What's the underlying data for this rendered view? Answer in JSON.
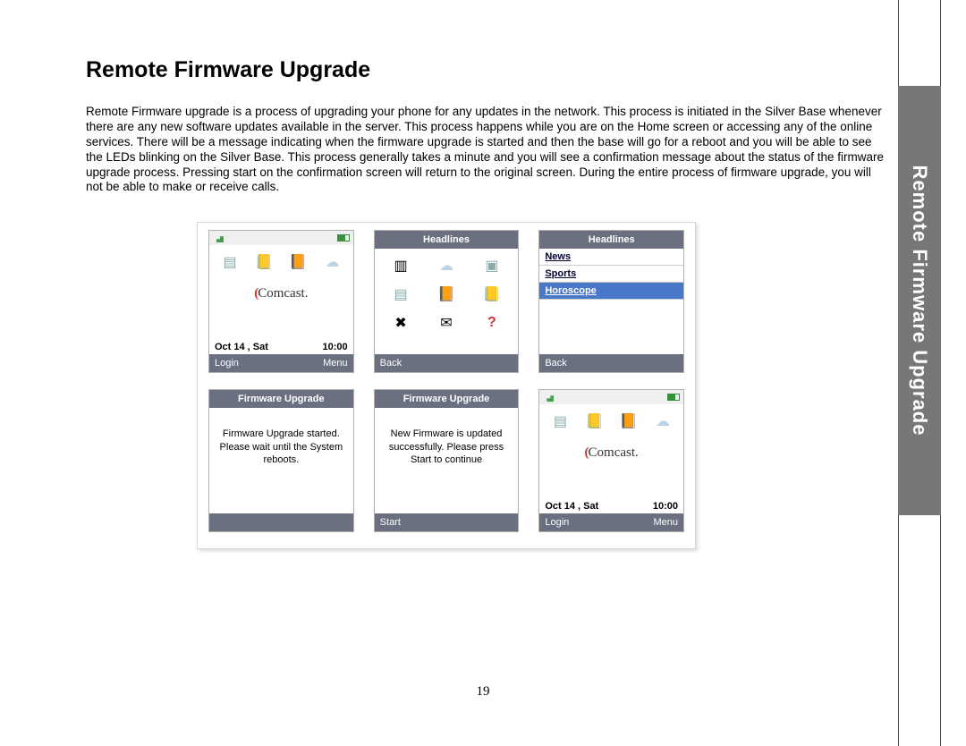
{
  "page": {
    "title": "Remote Firmware Upgrade",
    "body": "Remote Firmware upgrade is a process of upgrading your phone for any updates in the network. This process is initiated in the Silver Base whenever there are any new software updates available in the server. This process happens while you are on the Home screen or accessing any of the online services. There will be a message indicating when the firmware upgrade is started and then the base will go for a reboot and you will be able to see the LEDs blinking on the Silver Base. This process generally takes a minute and you will see a confirmation message about the status of the firmware upgrade process. Pressing start on the confirmation screen will return to the original screen. During the entire process of firmware upgrade, you will not be able to make or receive calls.",
    "number": "19",
    "side_tab": "Remote Firmware Upgrade"
  },
  "screens": {
    "s1_home": {
      "brand": "Comcast.",
      "date": "Oct 14 , Sat",
      "time": "10:00",
      "left": "Login",
      "right": "Menu"
    },
    "s2_headlines_grid": {
      "title": "Headlines",
      "left": "Back"
    },
    "s3_headlines_list": {
      "title": "Headlines",
      "items": [
        "News",
        "Sports",
        "Horoscope"
      ],
      "left": "Back"
    },
    "s4_fw_started": {
      "title": "Firmware Upgrade",
      "msg": "Firmware Upgrade started. Please wait until the System reboots."
    },
    "s5_fw_done": {
      "title": "Firmware Upgrade",
      "msg": "New Firmware is updated successfully. Please press Start to continue",
      "left": "Start"
    },
    "s6_home": {
      "brand": "Comcast.",
      "date": "Oct 14 , Sat",
      "time": "10:00",
      "left": "Login",
      "right": "Menu"
    }
  }
}
